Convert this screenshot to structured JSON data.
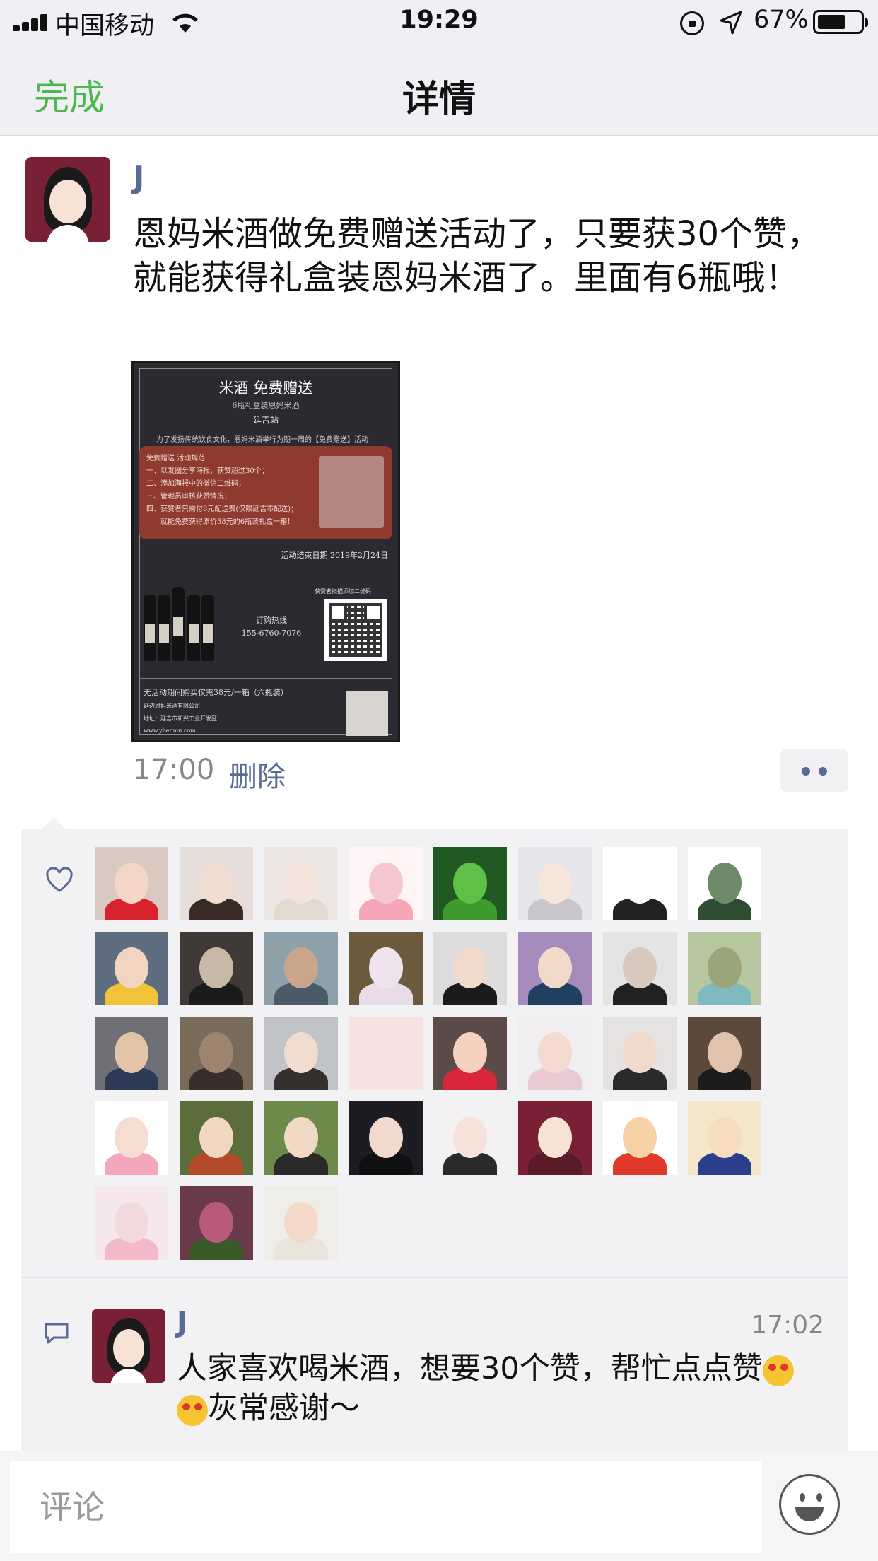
{
  "status_bar": {
    "carrier": "中国移动",
    "time": "19:29",
    "battery": "67%",
    "battery_level": 0.67
  },
  "nav": {
    "done_label": "完成",
    "title": "详情"
  },
  "post": {
    "author": "J",
    "text": "恩妈米酒做免费赠送活动了，只要获30个赞，就能获得礼盒装恩妈米酒了。里面有6瓶哦！",
    "time": "17:00",
    "delete_label": "删除",
    "poster": {
      "title": "米酒 免费赠送",
      "subtitle": "6瓶礼盒装恩妈米酒",
      "station": "延吉站",
      "intro": "为了发扬传统饮食文化，恩妈米酒举行为期一周的【免费赠送】活动！",
      "rules": [
        "免费赠送 活动规范",
        "一、以发圈分享海报，获赞超过30个；",
        "二、添加海报中的微信二维码；",
        "三、管理员审核获赞情况；",
        "四、获赞者只需付8元配送费(仅限延吉市配送)；",
        "　　就能免费获得原价58元的6瓶装礼盒一箱！"
      ],
      "end_date": "活动结束日期 2019年2月24日",
      "qr_caption": "获赞者扫描添加二维码",
      "hotline_label": "订购热线",
      "hotline": "155-6760-7076",
      "footer": [
        "无活动期间购买仅需38元/一箱（六瓶装）",
        "延边恩妈米酒有限公司",
        "地址：延吉市新兴工业开发区",
        "www.ybenmu.com"
      ]
    }
  },
  "likes": {
    "rows": 5,
    "avatars": [
      {
        "name": "l1",
        "bg": "#d9c9c0",
        "face": "#f3d6c5",
        "body": "#d8232f"
      },
      {
        "name": "l2",
        "bg": "#e6dedb",
        "face": "#f1ddd1",
        "body": "#3a2a24"
      },
      {
        "name": "l3",
        "bg": "#ede7e3",
        "face": "#f4e3da",
        "body": "#e4d9cf"
      },
      {
        "name": "l4",
        "bg": "#fff4f6",
        "face": "#f6c6cf",
        "body": "#f6a6b5"
      },
      {
        "name": "l5",
        "bg": "#205a22",
        "face": "#5fbf46",
        "body": "#3f9b30"
      },
      {
        "name": "l6",
        "bg": "#e6e6ea",
        "face": "#f6e6dc",
        "body": "#c9c7cb"
      },
      {
        "name": "l7",
        "bg": "#ffffff",
        "face": "#ffffff",
        "body": "#222222"
      },
      {
        "name": "l8",
        "bg": "#ffffff",
        "face": "#6e8a6a",
        "body": "#2f4d33"
      },
      {
        "name": "l9",
        "bg": "#5e6d7f",
        "face": "#f2d5c0",
        "body": "#f0c33a"
      },
      {
        "name": "l10",
        "bg": "#3f3a36",
        "face": "#c8b8a8",
        "body": "#1b1b1b"
      },
      {
        "name": "l11",
        "bg": "#8ea1ab",
        "face": "#c9a58b",
        "body": "#4a5a66"
      },
      {
        "name": "l12",
        "bg": "#6b5a3e",
        "face": "#efe4ee",
        "body": "#e8dce9"
      },
      {
        "name": "l13",
        "bg": "#dcdcdc",
        "face": "#f1d9cb",
        "body": "#1b1b1b"
      },
      {
        "name": "l14",
        "bg": "#a68bbd",
        "face": "#f2dacb",
        "body": "#1f4060"
      },
      {
        "name": "l15",
        "bg": "#e4e4e6",
        "face": "#d9c8be",
        "body": "#222222"
      },
      {
        "name": "l16",
        "bg": "#b7c7a0",
        "face": "#9aa67a",
        "body": "#7fbac0"
      },
      {
        "name": "l17",
        "bg": "#6e7075",
        "face": "#e3c4a8",
        "body": "#2c3a55"
      },
      {
        "name": "l18",
        "bg": "#7a6a5a",
        "face": "#9c8470",
        "body": "#3a2f28"
      },
      {
        "name": "l19",
        "bg": "#c0c3c8",
        "face": "#f2dcd0",
        "body": "#33302e"
      },
      {
        "name": "l20",
        "bg": "#f7e1e1",
        "face": "#f7e1e1",
        "body": "#f7e1e1"
      },
      {
        "name": "l21",
        "bg": "#5a4a48",
        "face": "#f4d1c0",
        "body": "#d9263a"
      },
      {
        "name": "l22",
        "bg": "#f1eef1",
        "face": "#f4dad0",
        "body": "#e9c9d2"
      },
      {
        "name": "l23",
        "bg": "#e6e2e2",
        "face": "#f1dacb",
        "body": "#2a2a2a"
      },
      {
        "name": "l24",
        "bg": "#5b4a3b",
        "face": "#e1c3ad",
        "body": "#1c1c1c"
      },
      {
        "name": "l25",
        "bg": "#ffffff",
        "face": "#f6ddd2",
        "body": "#f4a6bd"
      },
      {
        "name": "l26",
        "bg": "#5b6d3a",
        "face": "#f1d6c3",
        "body": "#b34a2a"
      },
      {
        "name": "l27",
        "bg": "#6e8a4a",
        "face": "#f1d9c6",
        "body": "#2a2a2a"
      },
      {
        "name": "l28",
        "bg": "#1c1c22",
        "face": "#f2d9cd",
        "body": "#101010"
      },
      {
        "name": "l29",
        "bg": "#f4f1f2",
        "face": "#f7e2d9",
        "body": "#2a2a2a"
      },
      {
        "name": "l30",
        "bg": "#7a2035",
        "face": "#f6e3d6",
        "body": "#5a1a28"
      },
      {
        "name": "l31",
        "bg": "#ffffff",
        "face": "#f6d2a6",
        "body": "#e23a2a"
      },
      {
        "name": "l32",
        "bg": "#f4e6c8",
        "face": "#f7dcbf",
        "body": "#2b3d8c"
      },
      {
        "name": "l33",
        "bg": "#f6e7ee",
        "face": "#f2d9de",
        "body": "#f2b9c8"
      },
      {
        "name": "l34",
        "bg": "#6a3a4a",
        "face": "#b85a7a",
        "body": "#3a5a2a"
      },
      {
        "name": "l35",
        "bg": "#efede8",
        "face": "#f3d9c7",
        "body": "#e9e4dc"
      }
    ]
  },
  "comment": {
    "author": "J",
    "time": "17:02",
    "text_part1": "人家喜欢喝米酒，想要30个赞，帮忙点点赞",
    "text_part2": "灰常感谢～",
    "emoji": "heart-eyes-emoji"
  },
  "composer": {
    "placeholder": "评论"
  }
}
